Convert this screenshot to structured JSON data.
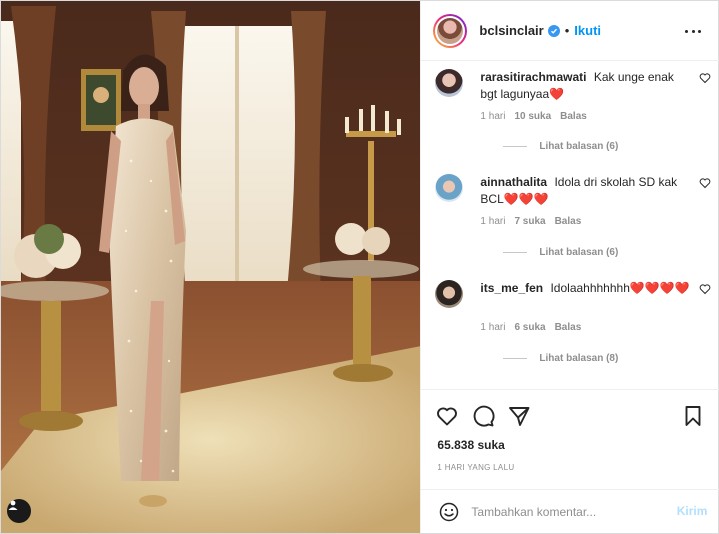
{
  "header": {
    "username": "bclsinclair",
    "verified_icon": "verified-badge-icon",
    "separator": "•",
    "follow_label": "Ikuti",
    "more_icon": "more-options-icon"
  },
  "comments": [
    {
      "username": "rarasitirachmawati",
      "text": "Kak unge enak bgt lagunyaa❤️",
      "age": "1 hari",
      "likes": "10 suka",
      "reply_label": "Balas",
      "view_replies": "Lihat balasan (6)"
    },
    {
      "username": "ainnathalita",
      "text": "Idola dri skolah SD kak BCL❤️❤️❤️",
      "age": "1 hari",
      "likes": "7 suka",
      "reply_label": "Balas",
      "view_replies": "Lihat balasan (6)"
    },
    {
      "username": "its_me_fen",
      "text": "Idolaahhhhhhh❤️❤️❤️❤️",
      "age": "1 hari",
      "likes": "6 suka",
      "reply_label": "Balas",
      "view_replies": "Lihat balasan (8)"
    }
  ],
  "actions": {
    "like_icon": "heart-icon",
    "comment_icon": "comment-icon",
    "share_icon": "send-icon",
    "save_icon": "bookmark-icon",
    "likes_count": "65.838 suka",
    "timestamp": "1 HARI YANG LALU"
  },
  "composer": {
    "emoji_icon": "emoji-icon",
    "placeholder": "Tambahkan komentar...",
    "post_label": "Kirim"
  },
  "colors": {
    "link_blue": "#0095f6",
    "post_disabled": "#b2dffc",
    "muted": "#8e8e8e",
    "heart_red": "#ed4956"
  }
}
